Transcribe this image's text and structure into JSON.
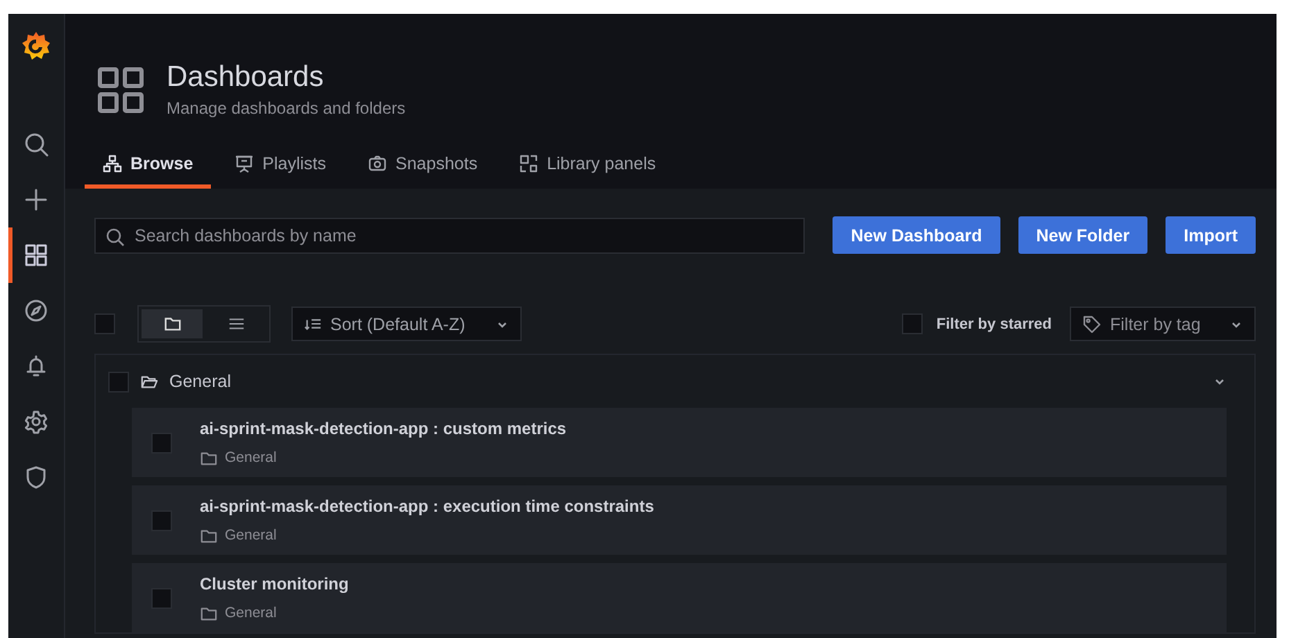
{
  "sidebar": {
    "items": [
      {
        "selected": false
      },
      {
        "selected": false
      },
      {
        "selected": true
      },
      {
        "selected": false
      },
      {
        "selected": false
      },
      {
        "selected": false
      },
      {
        "selected": false
      }
    ]
  },
  "header": {
    "title": "Dashboards",
    "subtitle": "Manage dashboards and folders"
  },
  "tabs": [
    {
      "label": "Browse",
      "selected": true
    },
    {
      "label": "Playlists",
      "selected": false
    },
    {
      "label": "Snapshots",
      "selected": false
    },
    {
      "label": "Library panels",
      "selected": false
    }
  ],
  "search": {
    "placeholder": "Search dashboards by name"
  },
  "buttons": [
    "New Dashboard",
    "New Folder",
    "Import"
  ],
  "toolbar": {
    "select_all_checked": false,
    "view_modes": [
      {
        "selected": true
      },
      {
        "selected": false
      }
    ],
    "sort": "Sort (Default A-Z)",
    "starred_filter": {
      "label": "Filter by starred",
      "checked": false
    },
    "tag_filter": {
      "placeholder": "Filter by tag"
    }
  },
  "folder": {
    "name": "General",
    "checked": false,
    "expanded": true,
    "dashboards": [
      {
        "title": "ai-sprint-mask-detection-app : custom metrics",
        "folder": "General",
        "checked": false
      },
      {
        "title": "ai-sprint-mask-detection-app : execution time constraints",
        "folder": "General",
        "checked": false
      },
      {
        "title": "Cluster monitoring",
        "folder": "General",
        "checked": false
      }
    ]
  }
}
